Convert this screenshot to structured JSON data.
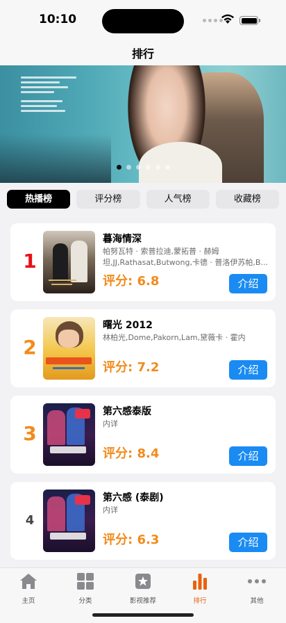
{
  "status_bar": {
    "time": "10:10"
  },
  "nav": {
    "title": "排行"
  },
  "banner": {
    "page_count": 6,
    "active_index": 0
  },
  "tabs": [
    {
      "label": "热播榜",
      "active": true
    },
    {
      "label": "评分榜",
      "active": false
    },
    {
      "label": "人气榜",
      "active": false
    },
    {
      "label": "收藏榜",
      "active": false
    }
  ],
  "list": [
    {
      "rank": "1",
      "rank_color": "#e8101a",
      "title": "暮海情深",
      "cast": "帕努瓦特 · 索普拉迪,蒙拓普 · 赫姆坦,JJ,Rathasat,Butwong,卡德 · 普洛伊苏帕,B...",
      "score": "评分: 6.8",
      "button": "介绍"
    },
    {
      "rank": "2",
      "rank_color": "#f28b1c",
      "title": "曙光 2012",
      "cast": "林柏光,Dome,Pakorn,Lam,黛薇卡 · 霍内",
      "score": "评分: 7.2",
      "button": "介绍"
    },
    {
      "rank": "3",
      "rank_color": "#f28b1c",
      "title": "第六感泰版",
      "cast": "内详",
      "score": "评分: 8.4",
      "button": "介绍"
    },
    {
      "rank": "4",
      "rank_color": "#444444",
      "title": "第六感 (泰剧)",
      "cast": "内详",
      "score": "评分: 6.3",
      "button": "介绍"
    }
  ],
  "tabbar": [
    {
      "label": "主页",
      "icon": "home-icon",
      "active": false
    },
    {
      "label": "分类",
      "icon": "grid-icon",
      "active": false
    },
    {
      "label": "影视推荐",
      "icon": "star-icon",
      "active": false
    },
    {
      "label": "排行",
      "icon": "bar-chart-icon",
      "active": true
    },
    {
      "label": "其他",
      "icon": "more-icon",
      "active": false
    }
  ],
  "colors": {
    "accent": "#e8620c",
    "score": "#f28b1c",
    "button": "#1a8bf2"
  }
}
